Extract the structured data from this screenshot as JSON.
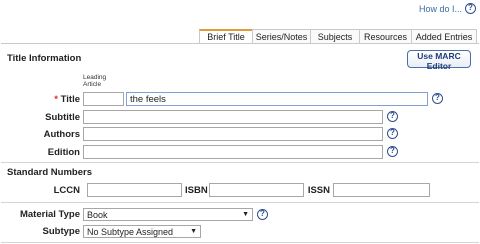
{
  "header": {
    "how_do_i": "How do I...",
    "help_glyph": "?"
  },
  "tabs": [
    {
      "label": "Brief Title",
      "active": true
    },
    {
      "label": "Series/Notes",
      "active": false
    },
    {
      "label": "Subjects",
      "active": false
    },
    {
      "label": "Resources",
      "active": false
    },
    {
      "label": "Added Entries",
      "active": false
    }
  ],
  "title_info": {
    "heading": "Title Information",
    "marc_button": "Use MARC Editor",
    "leading_article_label": "Leading Article",
    "required_marker": "*",
    "title_label": "Title",
    "title_value": "the feels",
    "leading_article_value": "",
    "subtitle_label": "Subtitle",
    "subtitle_value": "",
    "authors_label": "Authors",
    "authors_value": "",
    "edition_label": "Edition",
    "edition_value": ""
  },
  "standard_numbers": {
    "heading": "Standard Numbers",
    "lccn_label": "LCCN",
    "lccn_value": "",
    "isbn_label": "ISBN",
    "isbn_value": "",
    "issn_label": "ISSN",
    "issn_value": ""
  },
  "material": {
    "material_type_label": "Material Type",
    "material_type_value": "Book",
    "subtype_label": "Subtype",
    "subtype_value": "No Subtype Assigned",
    "dropdown_arrow": "▼"
  },
  "colors": {
    "accent_tab": "#e39a3b",
    "required": "#d83030",
    "link": "#3a6aa5",
    "help": "#2f4f8f"
  }
}
